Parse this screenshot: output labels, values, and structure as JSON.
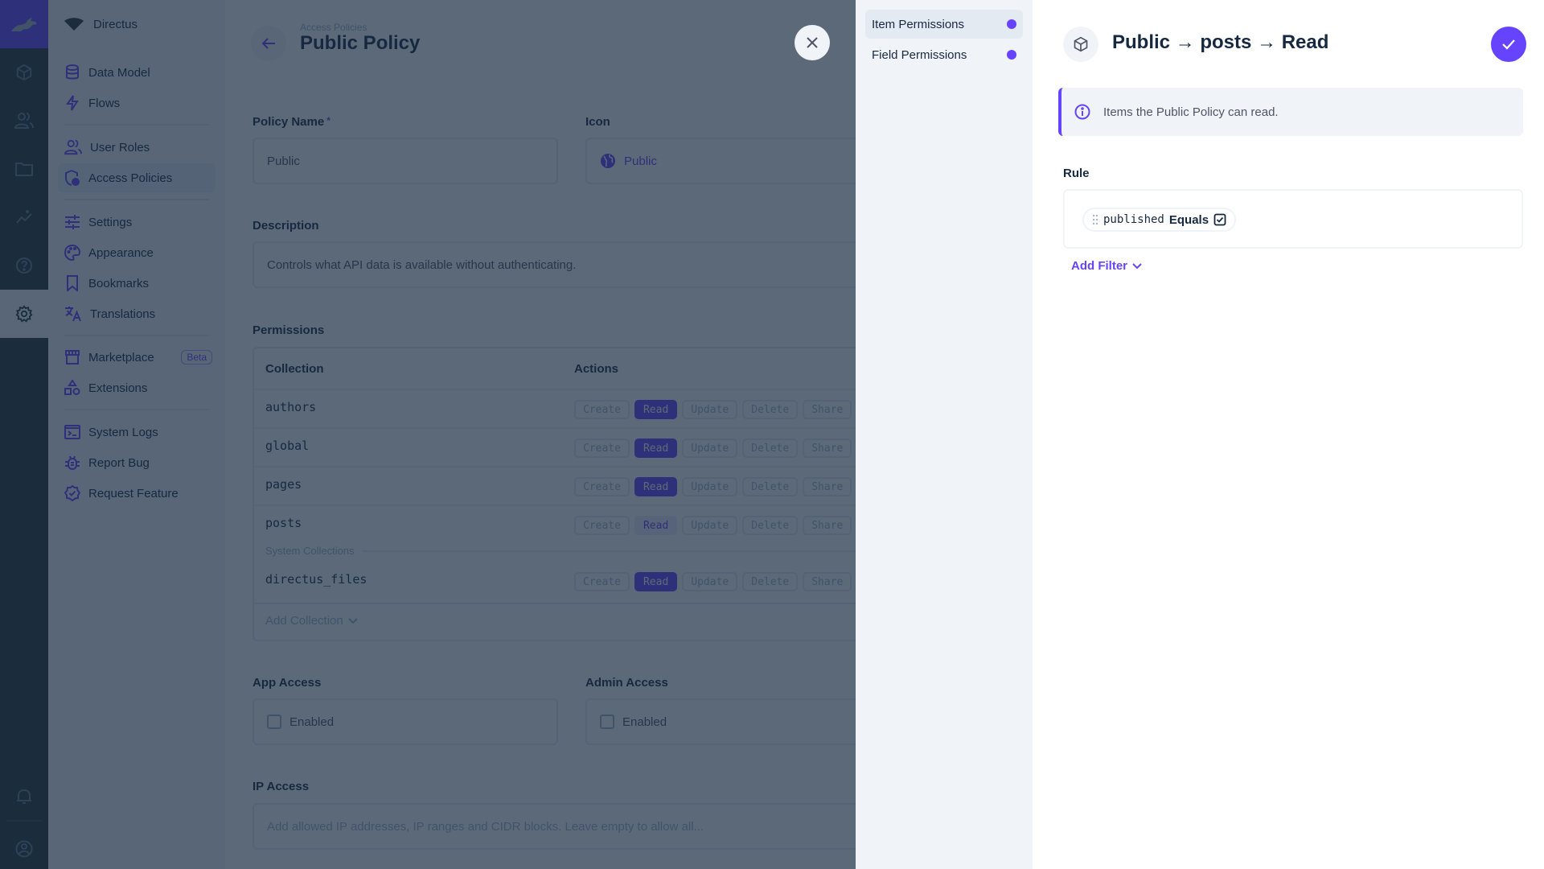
{
  "rail": {
    "items": [
      {
        "name": "content",
        "icon": "cube-icon"
      },
      {
        "name": "users",
        "icon": "users-icon"
      },
      {
        "name": "files",
        "icon": "folder-icon"
      },
      {
        "name": "insights",
        "icon": "insights-icon"
      },
      {
        "name": "help",
        "icon": "help-icon"
      },
      {
        "name": "settings",
        "icon": "gear-icon",
        "active": true
      }
    ],
    "bottom": [
      {
        "name": "notifications",
        "icon": "bell-icon"
      },
      {
        "name": "user",
        "icon": "user-icon"
      }
    ]
  },
  "navbar": {
    "project": "Directus",
    "items": [
      {
        "label": "Data Model",
        "icon": "database-icon"
      },
      {
        "label": "Flows",
        "icon": "bolt-icon"
      },
      {
        "label": "User Roles",
        "icon": "users-icon"
      },
      {
        "label": "Access Policies",
        "icon": "policy-icon",
        "active": true
      },
      {
        "label": "Settings",
        "icon": "tune-icon"
      },
      {
        "label": "Appearance",
        "icon": "palette-icon"
      },
      {
        "label": "Bookmarks",
        "icon": "bookmark-icon"
      },
      {
        "label": "Translations",
        "icon": "translate-icon"
      },
      {
        "label": "Marketplace",
        "icon": "store-icon",
        "badge": "Beta"
      },
      {
        "label": "Extensions",
        "icon": "extensions-icon"
      },
      {
        "label": "System Logs",
        "icon": "terminal-icon"
      },
      {
        "label": "Report Bug",
        "icon": "bug-icon"
      },
      {
        "label": "Request Feature",
        "icon": "verified-icon"
      }
    ]
  },
  "header": {
    "breadcrumb": "Access Policies",
    "title": "Public Policy"
  },
  "form": {
    "policy_name": {
      "label": "Policy Name",
      "required_mark": "*",
      "value": "Public"
    },
    "icon": {
      "label": "Icon",
      "value": "Public",
      "icon": "public-globe-icon"
    },
    "description": {
      "label": "Description",
      "value": "Controls what API data is available without authenticating."
    },
    "permissions": {
      "label": "Permissions",
      "columns": [
        "Collection",
        "Actions"
      ],
      "action_labels": [
        "Create",
        "Read",
        "Update",
        "Delete",
        "Share"
      ],
      "rows": [
        {
          "collection": "authors",
          "actions": {
            "Create": "none",
            "Read": "all",
            "Update": "none",
            "Delete": "none",
            "Share": "none"
          }
        },
        {
          "collection": "global",
          "actions": {
            "Create": "none",
            "Read": "all",
            "Update": "none",
            "Delete": "none",
            "Share": "none"
          }
        },
        {
          "collection": "pages",
          "actions": {
            "Create": "none",
            "Read": "all",
            "Update": "none",
            "Delete": "none",
            "Share": "none"
          }
        },
        {
          "collection": "posts",
          "actions": {
            "Create": "none",
            "Read": "custom",
            "Update": "none",
            "Delete": "none",
            "Share": "none"
          }
        }
      ],
      "system_label": "System Collections",
      "system_rows": [
        {
          "collection": "directus_files",
          "actions": {
            "Create": "none",
            "Read": "all",
            "Update": "none",
            "Delete": "none",
            "Share": "none"
          }
        }
      ],
      "add_collection": "Add Collection"
    },
    "app_access": {
      "label": "App Access",
      "checkbox_label": "Enabled",
      "checked": false
    },
    "admin_access": {
      "label": "Admin Access",
      "checkbox_label": "Enabled",
      "checked": false
    },
    "ip_access": {
      "label": "IP Access",
      "placeholder": "Add allowed IP addresses, IP ranges and CIDR blocks. Leave empty to allow all..."
    }
  },
  "drawer": {
    "nav": [
      {
        "label": "Item Permissions",
        "active": true,
        "indicator": true
      },
      {
        "label": "Field Permissions",
        "active": false,
        "indicator": true
      }
    ],
    "title": "Public → posts → Read",
    "notice": "Items the Public Policy can read.",
    "rule_label": "Rule",
    "filter": {
      "field": "published",
      "operator": "Equals",
      "value": "checked"
    },
    "add_filter": "Add Filter"
  },
  "colors": {
    "accent": "#6644ff",
    "text": "#172940",
    "background_subdued": "#f0f4f9",
    "rail": "#263238"
  }
}
